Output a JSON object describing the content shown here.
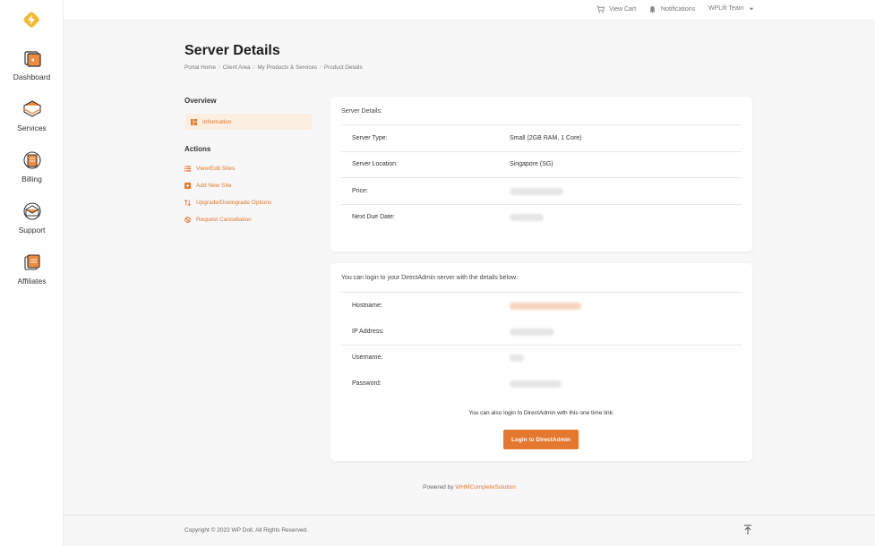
{
  "sidebar": {
    "items": [
      {
        "label": "Dashboard",
        "icon": "dashboard-icon"
      },
      {
        "label": "Services",
        "icon": "services-icon"
      },
      {
        "label": "Billing",
        "icon": "billing-icon"
      },
      {
        "label": "Support",
        "icon": "support-icon"
      },
      {
        "label": "Affiliates",
        "icon": "affiliates-icon"
      }
    ]
  },
  "topbar": {
    "view_cart": "View Cart",
    "notifications": "Notifications",
    "account": "WPLift Team"
  },
  "page": {
    "title": "Server Details",
    "breadcrumb": [
      "Portal Home",
      "Client Area",
      "My Products & Services",
      "Product Details"
    ]
  },
  "sidenav": {
    "overview_heading": "Overview",
    "information": "Information",
    "actions_heading": "Actions",
    "actions": [
      "View/Edit Sites",
      "Add New Site",
      "Upgrade/Downgrade Options",
      "Request Cancellation"
    ]
  },
  "server_card": {
    "heading": "Server Details:",
    "rows": [
      {
        "label": "Server Type:",
        "value": "Small (2GB RAM, 1 Core)"
      },
      {
        "label": "Server Location:",
        "value": "Singapore (SG)"
      },
      {
        "label": "Price:",
        "value": ""
      },
      {
        "label": "Next Due Date:",
        "value": ""
      }
    ]
  },
  "login_card": {
    "intro": "You can login to your DirectAdmin server with the details below:",
    "rows": [
      {
        "label": "Hostname:"
      },
      {
        "label": "IP Address:"
      },
      {
        "label": "Username:"
      },
      {
        "label": "Password:"
      }
    ],
    "note": "You can also login to DirectAdmin with this one time link:",
    "button": "Login to DirectAdmin"
  },
  "powered": {
    "prefix": "Powered by",
    "link": "WHMCompleteSolution"
  },
  "footer": {
    "copyright": "Copyright © 2022 WP Doll. All Rights Reserved."
  },
  "colors": {
    "accent": "#e3782e",
    "accent_light": "#fdeee2",
    "logo_yellow": "#f5b82e"
  }
}
